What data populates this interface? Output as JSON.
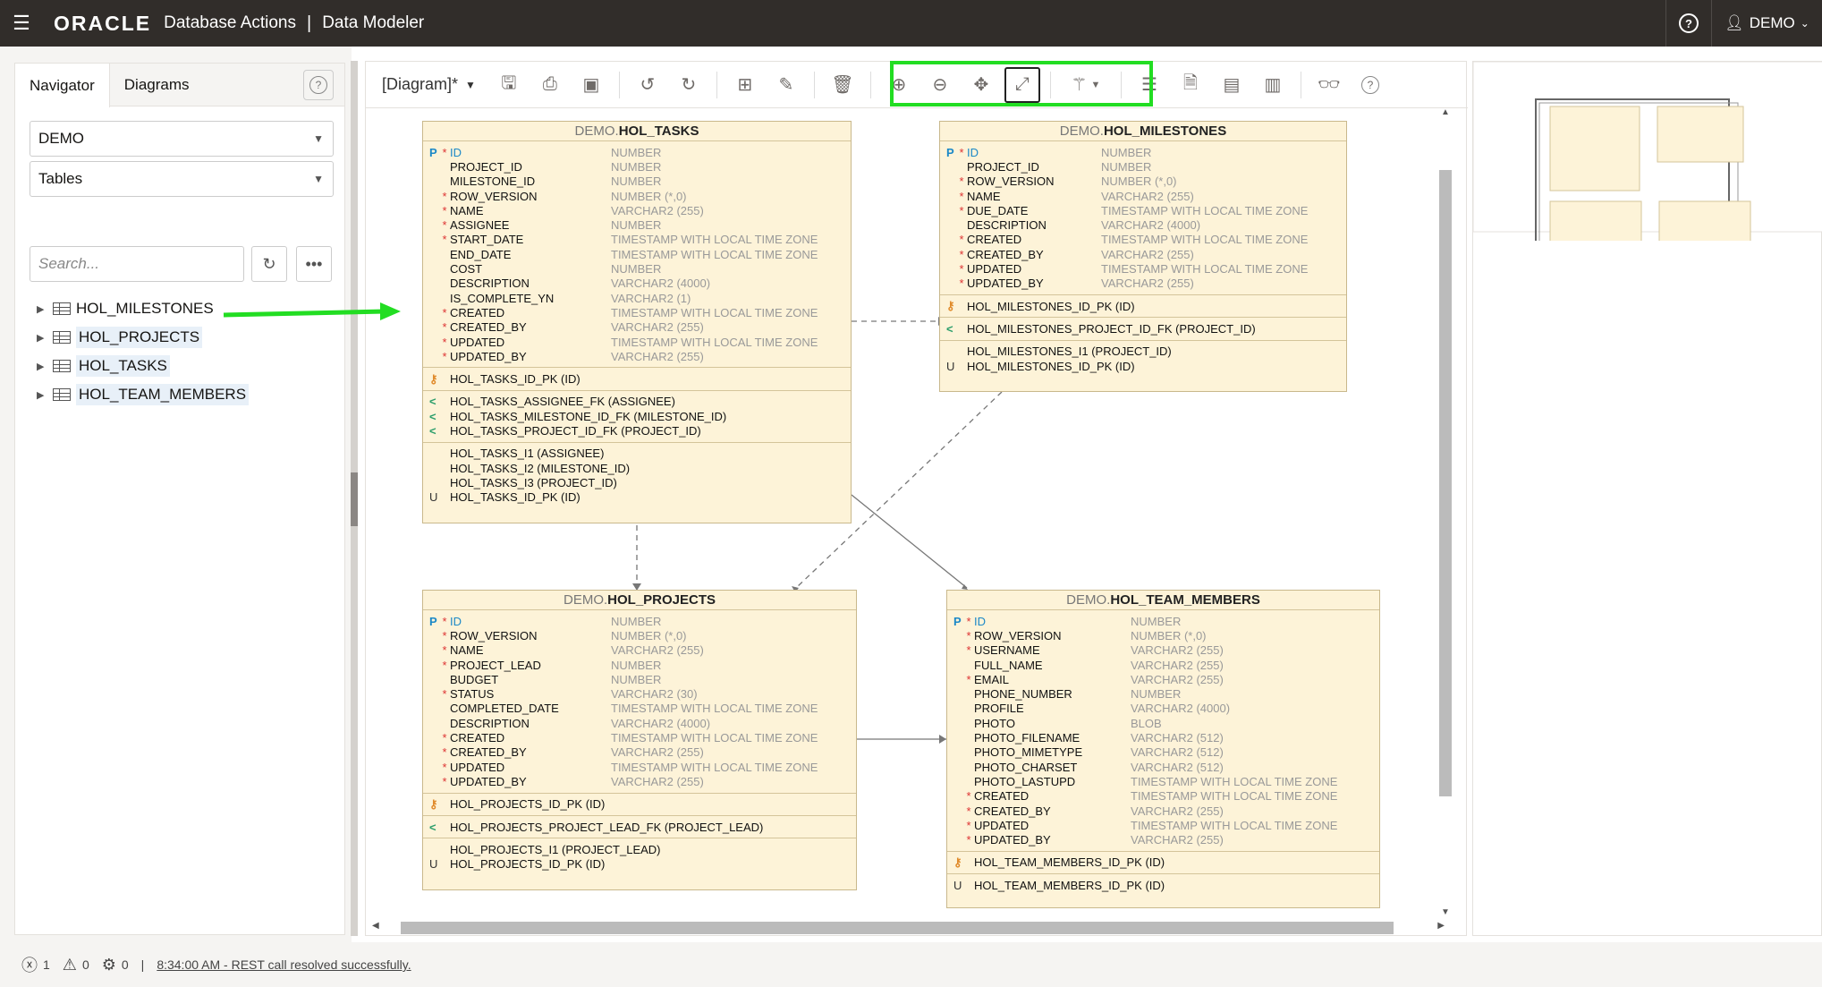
{
  "header": {
    "brand": "ORACLE",
    "product": "Database Actions",
    "separator": "|",
    "page": "Data Modeler",
    "help_icon": "help-circle-icon",
    "user": "DEMO"
  },
  "navigator": {
    "tabs": [
      "Navigator",
      "Diagrams"
    ],
    "schema": "DEMO",
    "object_type": "Tables",
    "search_placeholder": "Search...",
    "tables": [
      "HOL_MILESTONES",
      "HOL_PROJECTS",
      "HOL_TASKS",
      "HOL_TEAM_MEMBERS"
    ]
  },
  "diagram_toolbar": {
    "diagram_name": "[Diagram]*"
  },
  "colors": {
    "highlight": "#22dd22",
    "arrow": "#22dd22",
    "entity_bg": "#fdf3d8"
  },
  "entities": {
    "tasks": {
      "schema": "DEMO.",
      "name": "HOL_TASKS",
      "columns": [
        {
          "pk": "P",
          "mand": "*",
          "name": "ID",
          "type": "NUMBER"
        },
        {
          "pk": "",
          "mand": "",
          "name": "PROJECT_ID",
          "type": "NUMBER"
        },
        {
          "pk": "",
          "mand": "",
          "name": "MILESTONE_ID",
          "type": "NUMBER"
        },
        {
          "pk": "",
          "mand": "*",
          "name": "ROW_VERSION",
          "type": "NUMBER (*,0)"
        },
        {
          "pk": "",
          "mand": "*",
          "name": "NAME",
          "type": "VARCHAR2 (255)"
        },
        {
          "pk": "",
          "mand": "*",
          "name": "ASSIGNEE",
          "type": "NUMBER"
        },
        {
          "pk": "",
          "mand": "*",
          "name": "START_DATE",
          "type": "TIMESTAMP WITH LOCAL TIME ZONE"
        },
        {
          "pk": "",
          "mand": "",
          "name": "END_DATE",
          "type": "TIMESTAMP WITH LOCAL TIME ZONE"
        },
        {
          "pk": "",
          "mand": "",
          "name": "COST",
          "type": "NUMBER"
        },
        {
          "pk": "",
          "mand": "",
          "name": "DESCRIPTION",
          "type": "VARCHAR2 (4000)"
        },
        {
          "pk": "",
          "mand": "",
          "name": "IS_COMPLETE_YN",
          "type": "VARCHAR2 (1)"
        },
        {
          "pk": "",
          "mand": "*",
          "name": "CREATED",
          "type": "TIMESTAMP WITH LOCAL TIME ZONE"
        },
        {
          "pk": "",
          "mand": "*",
          "name": "CREATED_BY",
          "type": "VARCHAR2 (255)"
        },
        {
          "pk": "",
          "mand": "*",
          "name": "UPDATED",
          "type": "TIMESTAMP WITH LOCAL TIME ZONE"
        },
        {
          "pk": "",
          "mand": "*",
          "name": "UPDATED_BY",
          "type": "VARCHAR2 (255)"
        }
      ],
      "keys": [
        "HOL_TASKS_ID_PK (ID)"
      ],
      "fks": [
        "HOL_TASKS_ASSIGNEE_FK (ASSIGNEE)",
        "HOL_TASKS_MILESTONE_ID_FK (MILESTONE_ID)",
        "HOL_TASKS_PROJECT_ID_FK (PROJECT_ID)"
      ],
      "indexes": [
        {
          "u": "",
          "name": "HOL_TASKS_I1 (ASSIGNEE)"
        },
        {
          "u": "",
          "name": "HOL_TASKS_I2 (MILESTONE_ID)"
        },
        {
          "u": "",
          "name": "HOL_TASKS_I3 (PROJECT_ID)"
        },
        {
          "u": "U",
          "name": "HOL_TASKS_ID_PK (ID)"
        }
      ]
    },
    "milestones": {
      "schema": "DEMO.",
      "name": "HOL_MILESTONES",
      "columns": [
        {
          "pk": "P",
          "mand": "*",
          "name": "ID",
          "type": "NUMBER"
        },
        {
          "pk": "",
          "mand": "",
          "name": "PROJECT_ID",
          "type": "NUMBER"
        },
        {
          "pk": "",
          "mand": "*",
          "name": "ROW_VERSION",
          "type": "NUMBER (*,0)"
        },
        {
          "pk": "",
          "mand": "*",
          "name": "NAME",
          "type": "VARCHAR2 (255)"
        },
        {
          "pk": "",
          "mand": "*",
          "name": "DUE_DATE",
          "type": "TIMESTAMP WITH LOCAL TIME ZONE"
        },
        {
          "pk": "",
          "mand": "",
          "name": "DESCRIPTION",
          "type": "VARCHAR2 (4000)"
        },
        {
          "pk": "",
          "mand": "*",
          "name": "CREATED",
          "type": "TIMESTAMP WITH LOCAL TIME ZONE"
        },
        {
          "pk": "",
          "mand": "*",
          "name": "CREATED_BY",
          "type": "VARCHAR2 (255)"
        },
        {
          "pk": "",
          "mand": "*",
          "name": "UPDATED",
          "type": "TIMESTAMP WITH LOCAL TIME ZONE"
        },
        {
          "pk": "",
          "mand": "*",
          "name": "UPDATED_BY",
          "type": "VARCHAR2 (255)"
        }
      ],
      "keys": [
        "HOL_MILESTONES_ID_PK (ID)"
      ],
      "fks": [
        "HOL_MILESTONES_PROJECT_ID_FK (PROJECT_ID)"
      ],
      "indexes": [
        {
          "u": "",
          "name": "HOL_MILESTONES_I1 (PROJECT_ID)"
        },
        {
          "u": "U",
          "name": "HOL_MILESTONES_ID_PK (ID)"
        }
      ]
    },
    "projects": {
      "schema": "DEMO.",
      "name": "HOL_PROJECTS",
      "columns": [
        {
          "pk": "P",
          "mand": "*",
          "name": "ID",
          "type": "NUMBER"
        },
        {
          "pk": "",
          "mand": "*",
          "name": "ROW_VERSION",
          "type": "NUMBER (*,0)"
        },
        {
          "pk": "",
          "mand": "*",
          "name": "NAME",
          "type": "VARCHAR2 (255)"
        },
        {
          "pk": "",
          "mand": "*",
          "name": "PROJECT_LEAD",
          "type": "NUMBER"
        },
        {
          "pk": "",
          "mand": "",
          "name": "BUDGET",
          "type": "NUMBER"
        },
        {
          "pk": "",
          "mand": "*",
          "name": "STATUS",
          "type": "VARCHAR2 (30)"
        },
        {
          "pk": "",
          "mand": "",
          "name": "COMPLETED_DATE",
          "type": "TIMESTAMP WITH LOCAL TIME ZONE"
        },
        {
          "pk": "",
          "mand": "",
          "name": "DESCRIPTION",
          "type": "VARCHAR2 (4000)"
        },
        {
          "pk": "",
          "mand": "*",
          "name": "CREATED",
          "type": "TIMESTAMP WITH LOCAL TIME ZONE"
        },
        {
          "pk": "",
          "mand": "*",
          "name": "CREATED_BY",
          "type": "VARCHAR2 (255)"
        },
        {
          "pk": "",
          "mand": "*",
          "name": "UPDATED",
          "type": "TIMESTAMP WITH LOCAL TIME ZONE"
        },
        {
          "pk": "",
          "mand": "*",
          "name": "UPDATED_BY",
          "type": "VARCHAR2 (255)"
        }
      ],
      "keys": [
        "HOL_PROJECTS_ID_PK (ID)"
      ],
      "fks": [
        "HOL_PROJECTS_PROJECT_LEAD_FK (PROJECT_LEAD)"
      ],
      "indexes": [
        {
          "u": "",
          "name": "HOL_PROJECTS_I1 (PROJECT_LEAD)"
        },
        {
          "u": "U",
          "name": "HOL_PROJECTS_ID_PK (ID)"
        }
      ]
    },
    "team": {
      "schema": "DEMO.",
      "name": "HOL_TEAM_MEMBERS",
      "columns": [
        {
          "pk": "P",
          "mand": "*",
          "name": "ID",
          "type": "NUMBER"
        },
        {
          "pk": "",
          "mand": "*",
          "name": "ROW_VERSION",
          "type": "NUMBER (*,0)"
        },
        {
          "pk": "",
          "mand": "*",
          "name": "USERNAME",
          "type": "VARCHAR2 (255)"
        },
        {
          "pk": "",
          "mand": "",
          "name": "FULL_NAME",
          "type": "VARCHAR2 (255)"
        },
        {
          "pk": "",
          "mand": "*",
          "name": "EMAIL",
          "type": "VARCHAR2 (255)"
        },
        {
          "pk": "",
          "mand": "",
          "name": "PHONE_NUMBER",
          "type": "NUMBER"
        },
        {
          "pk": "",
          "mand": "",
          "name": "PROFILE",
          "type": "VARCHAR2 (4000)"
        },
        {
          "pk": "",
          "mand": "",
          "name": "PHOTO",
          "type": "BLOB"
        },
        {
          "pk": "",
          "mand": "",
          "name": "PHOTO_FILENAME",
          "type": "VARCHAR2 (512)"
        },
        {
          "pk": "",
          "mand": "",
          "name": "PHOTO_MIMETYPE",
          "type": "VARCHAR2 (512)"
        },
        {
          "pk": "",
          "mand": "",
          "name": "PHOTO_CHARSET",
          "type": "VARCHAR2 (512)"
        },
        {
          "pk": "",
          "mand": "",
          "name": "PHOTO_LASTUPD",
          "type": "TIMESTAMP WITH LOCAL TIME ZONE"
        },
        {
          "pk": "",
          "mand": "*",
          "name": "CREATED",
          "type": "TIMESTAMP WITH LOCAL TIME ZONE"
        },
        {
          "pk": "",
          "mand": "*",
          "name": "CREATED_BY",
          "type": "VARCHAR2 (255)"
        },
        {
          "pk": "",
          "mand": "*",
          "name": "UPDATED",
          "type": "TIMESTAMP WITH LOCAL TIME ZONE"
        },
        {
          "pk": "",
          "mand": "*",
          "name": "UPDATED_BY",
          "type": "VARCHAR2 (255)"
        }
      ],
      "keys": [
        "HOL_TEAM_MEMBERS_ID_PK (ID)"
      ],
      "fks": [],
      "indexes": [
        {
          "u": "U",
          "name": "HOL_TEAM_MEMBERS_ID_PK (ID)"
        }
      ]
    }
  },
  "status": {
    "errors": "1",
    "warnings": "0",
    "tasks": "0",
    "separator": "|",
    "message": "8:34:00 AM - REST call resolved successfully."
  }
}
